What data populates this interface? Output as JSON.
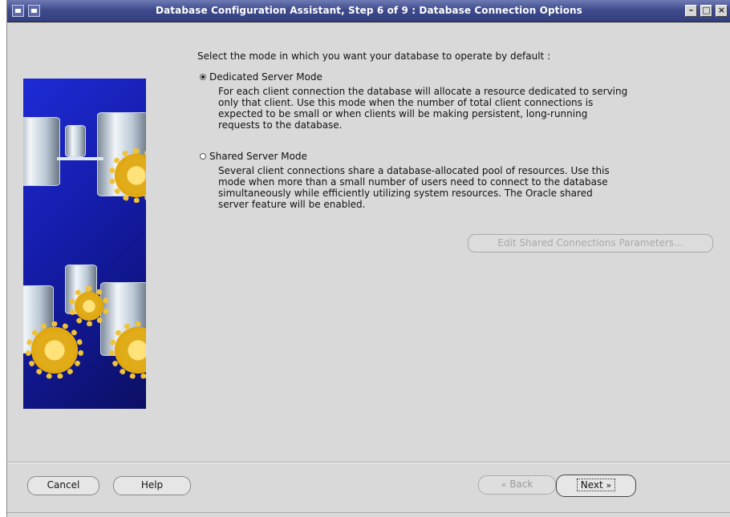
{
  "window": {
    "title": "Database Configuration Assistant, Step 6 of 9 : Database Connection Options"
  },
  "titlebar": {
    "buttons": [
      "minimize-icon",
      "maximize-icon",
      "close-icon"
    ]
  },
  "main": {
    "prompt": "Select the mode in which you want your database to operate by default :",
    "options": [
      {
        "label": "Dedicated Server Mode",
        "selected": true,
        "description": [
          "For each client connection the database will allocate a resource dedicated to serving",
          "only that client.  Use this mode when the number of total client connections is",
          "expected to be small or when clients will be making persistent, long-running",
          "requests to the database."
        ]
      },
      {
        "label": "Shared Server Mode",
        "selected": false,
        "description": [
          "Several client connections share a database-allocated pool of resources.  Use this",
          "mode when more than a small number of users need to connect to the database",
          "simultaneously while efficiently utilizing system resources.  The Oracle shared",
          "server feature will be enabled."
        ]
      }
    ],
    "edit_button": "Edit Shared Connections Parameters..."
  },
  "footer": {
    "cancel": "Cancel",
    "help": "Help",
    "back_arrow": "«",
    "back": "Back",
    "next": "Next",
    "next_arrow": "»"
  },
  "colors": {
    "title_bar": "#3f4b8c",
    "background": "#d9d9d9",
    "graphic": "#141ca8"
  }
}
